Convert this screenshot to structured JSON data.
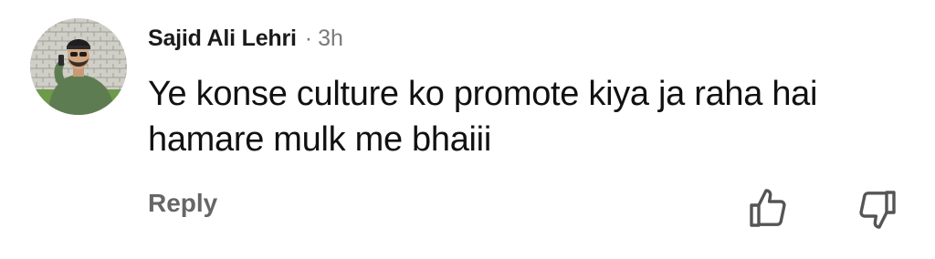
{
  "comment": {
    "author": "Sajid Ali Lehri",
    "separator": "·",
    "time": "3h",
    "text": "Ye konse culture ko promote kiya ja raha hai hamare mulk me bhaiii",
    "reply_label": "Reply"
  },
  "icons": {
    "like": "thumbs-up-icon",
    "dislike": "thumbs-down-icon"
  },
  "colors": {
    "author": "#1a1a1a",
    "meta": "#7a7a7a",
    "body": "#111111",
    "reply": "#666666",
    "icon": "#555555"
  }
}
